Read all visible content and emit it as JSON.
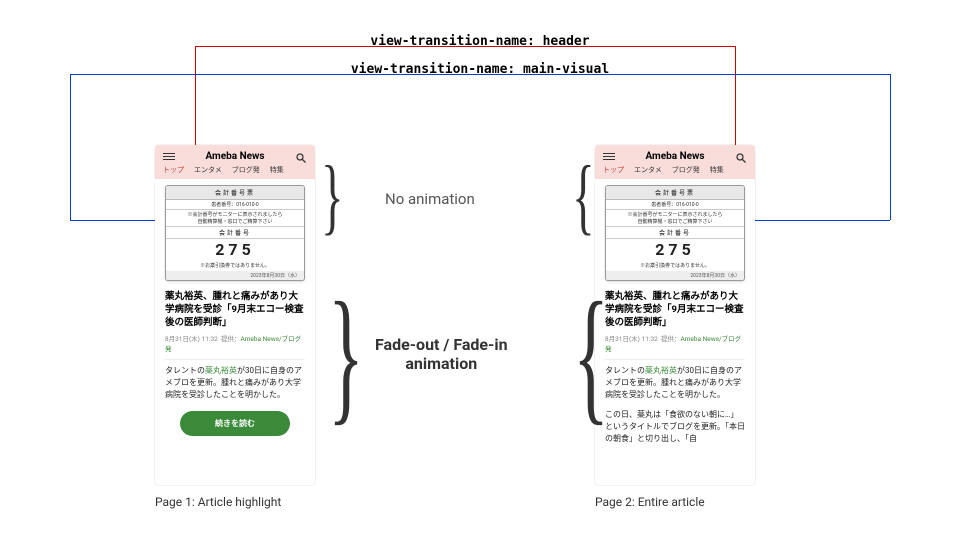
{
  "labels": {
    "header": "view-transition-name: header",
    "main_visual": "view-transition-name: main-visual"
  },
  "brand": "Ameba News",
  "tabs": [
    "トップ",
    "エンタメ",
    "ブログ発",
    "特集"
  ],
  "ticket": {
    "head": "会計番号票",
    "sub1": "患者番号：016-010-0",
    "sub2": "※会計番号がモニターに表示されましたら\n自動精算機・窓口でご精算下さい",
    "mid": "会計番号",
    "num": "275",
    "note": "※お薬引換券ではありません。",
    "date": "2023年8月30日（水）"
  },
  "article": {
    "headline": "薬丸裕英、腫れと痛みがあり大学病院を受診「9月末エコー検査後の医師判断」",
    "date": "8月31日(木) 11:32",
    "provider_label": "提供：",
    "provider": "Ameba News/ブログ発",
    "para1_a": "タレントの",
    "para1_kw": "薬丸裕英",
    "para1_b": "が30日に自身のアメブロを更新。腫れと痛みがあり大学病院を受診したことを明かした。",
    "para2": "この日、薬丸は「食欲のない朝に…」というタイトルでブログを更新。「本日の朝食」と切り出し、「自"
  },
  "cta": "続きを読む",
  "annotations": {
    "no_anim": "No animation",
    "fade": "Fade-out / Fade-in\nanimation"
  },
  "captions": {
    "left": "Page 1: Article highlight",
    "right": "Page 2: Entire article"
  }
}
